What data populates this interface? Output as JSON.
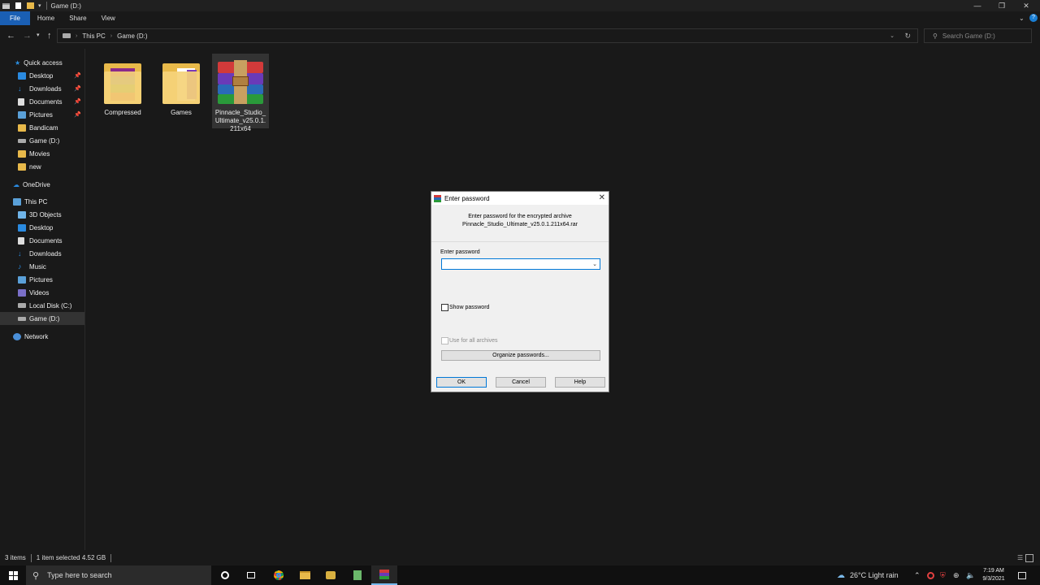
{
  "window": {
    "title": "Game (D:)",
    "controls": [
      "minimize",
      "maximize",
      "close"
    ]
  },
  "ribbon": {
    "tabs": [
      "File",
      "Home",
      "Share",
      "View"
    ]
  },
  "address": {
    "path": [
      "This PC",
      "Game (D:)"
    ],
    "search_placeholder": "Search Game (D:)"
  },
  "nav": {
    "quick_access": "Quick access",
    "quick_items": [
      "Desktop",
      "Downloads",
      "Documents",
      "Pictures",
      "Bandicam",
      "Game (D:)",
      "Movies",
      "new"
    ],
    "onedrive": "OneDrive",
    "this_pc": "This PC",
    "pc_items": [
      "3D Objects",
      "Desktop",
      "Documents",
      "Downloads",
      "Music",
      "Pictures",
      "Videos",
      "Local Disk (C:)",
      "Game (D:)"
    ],
    "network": "Network"
  },
  "files": [
    {
      "name": "Compressed",
      "type": "folder"
    },
    {
      "name": "Games",
      "type": "folder"
    },
    {
      "name_lines": [
        "Pinnacle_Studio_",
        "Ultimate_v25.0.1.",
        "211x64"
      ],
      "type": "rar"
    }
  ],
  "dialog": {
    "title": "Enter password",
    "message_line1": "Enter password for the encrypted archive",
    "message_line2": "Pinnacle_Studio_Ultimate_v25.0.1.211x64.rar",
    "field_label": "Enter password",
    "password_value": "",
    "show_password": "Show password",
    "use_for_all": "Use for all archives",
    "organize": "Organize passwords...",
    "ok": "OK",
    "cancel": "Cancel",
    "help": "Help"
  },
  "status": {
    "items": "3 items",
    "selected": "1 item selected  4.52 GB"
  },
  "taskbar": {
    "search_placeholder": "Type here to search",
    "weather": "26°C  Light rain",
    "time": "7:19 AM",
    "date": "9/3/2021"
  },
  "colors": {
    "file_tab": "#1a5fb4",
    "folder": "#e8b94a",
    "dialog_accent": "#0078d7"
  }
}
